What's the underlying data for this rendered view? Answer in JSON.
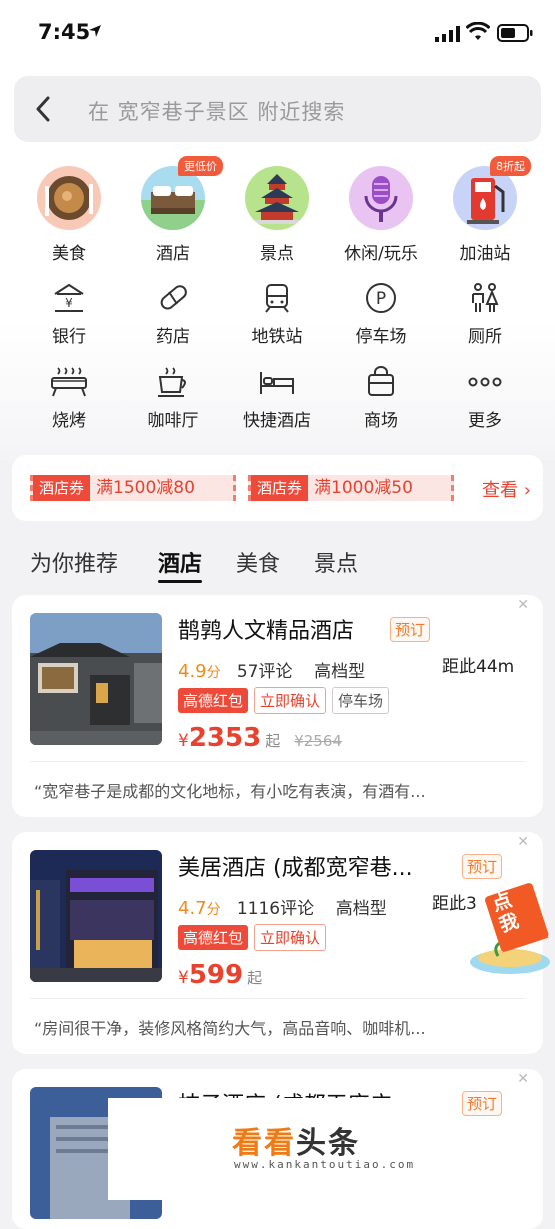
{
  "status_bar": {
    "time": "7:45"
  },
  "search": {
    "placeholder": "在 宽窄巷子景区 附近搜索"
  },
  "categories": [
    {
      "label": "美食",
      "icon": "food-icon"
    },
    {
      "label": "酒店",
      "icon": "hotel-icon",
      "badge": "更低价"
    },
    {
      "label": "景点",
      "icon": "temple-icon"
    },
    {
      "label": "休闲/玩乐",
      "icon": "microphone-icon"
    },
    {
      "label": "加油站",
      "icon": "gas-pump-icon",
      "badge": "8折起"
    }
  ],
  "services_row1": [
    {
      "label": "银行",
      "icon": "bank-icon"
    },
    {
      "label": "药店",
      "icon": "pill-icon"
    },
    {
      "label": "地铁站",
      "icon": "subway-icon"
    },
    {
      "label": "停车场",
      "icon": "parking-icon"
    },
    {
      "label": "厕所",
      "icon": "restroom-icon"
    }
  ],
  "services_row2": [
    {
      "label": "烧烤",
      "icon": "grill-icon"
    },
    {
      "label": "咖啡厅",
      "icon": "coffee-icon"
    },
    {
      "label": "快捷酒店",
      "icon": "bed-icon"
    },
    {
      "label": "商场",
      "icon": "shopping-bag-icon"
    },
    {
      "label": "更多",
      "icon": "more-dots-icon"
    }
  ],
  "coupons": {
    "items": [
      {
        "tag": "酒店券",
        "text": "满1500减80"
      },
      {
        "tag": "酒店券",
        "text": "满1000减50"
      }
    ],
    "view_more": "查看"
  },
  "tabs": [
    "为你推荐",
    "酒店",
    "美食",
    "景点"
  ],
  "hotels": [
    {
      "name": "鹊鹑人文精品酒店",
      "book": "预订",
      "score": "4.9",
      "score_unit": "分",
      "reviews": "57评论",
      "grade": "高档型",
      "distance": "距此44m",
      "tags": [
        "高德红包",
        "立即确认",
        "停车场"
      ],
      "currency": "¥",
      "price": "2353",
      "price_suffix": "起",
      "old_price": "¥2564",
      "review_snippet": "“宽窄巷子是成都的文化地标，有小吃有表演，有酒有..."
    },
    {
      "name": "美居酒店 (成都宽窄巷...",
      "book": "预订",
      "score": "4.7",
      "score_unit": "分",
      "reviews": "1116评论",
      "grade": "高档型",
      "distance": "距此3",
      "tags": [
        "高德红包",
        "立即确认"
      ],
      "currency": "¥",
      "price": "599",
      "price_suffix": "起",
      "review_snippet": "“房间很干净，装修风格简约大气，高品音响、咖啡机..."
    },
    {
      "name": "桔子酒店 (成都天府广",
      "book": "预订"
    }
  ],
  "promo": {
    "text": "点我"
  },
  "watermark": {
    "brand_a": "看看",
    "brand_b": "头条",
    "url": "www.kankantoutiao.com"
  }
}
